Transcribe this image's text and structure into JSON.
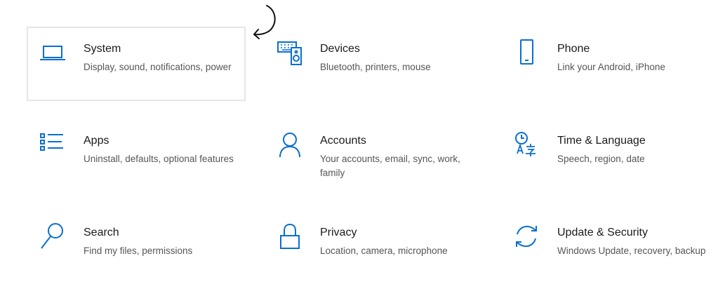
{
  "accent_color": "#0a6fd0",
  "selected_tile": "system",
  "annotation": {
    "icon": "curved-arrow-pointing-left-icon"
  },
  "tiles": {
    "system": {
      "title": "System",
      "description": "Display, sound, notifications, power",
      "icon": "laptop-icon"
    },
    "devices": {
      "title": "Devices",
      "description": "Bluetooth, printers, mouse",
      "icon": "keyboard-speaker-icon"
    },
    "phone": {
      "title": "Phone",
      "description": "Link your Android, iPhone",
      "icon": "phone-icon"
    },
    "apps": {
      "title": "Apps",
      "description": "Uninstall, defaults, optional features",
      "icon": "apps-list-icon"
    },
    "accounts": {
      "title": "Accounts",
      "description": "Your accounts, email, sync, work, family",
      "icon": "person-icon"
    },
    "time": {
      "title": "Time & Language",
      "description": "Speech, region, date",
      "icon": "time-language-icon"
    },
    "search": {
      "title": "Search",
      "description": "Find my files, permissions",
      "icon": "search-icon"
    },
    "privacy": {
      "title": "Privacy",
      "description": "Location, camera, microphone",
      "icon": "lock-icon"
    },
    "update": {
      "title": "Update & Security",
      "description": "Windows Update, recovery, backup",
      "icon": "sync-icon"
    }
  }
}
